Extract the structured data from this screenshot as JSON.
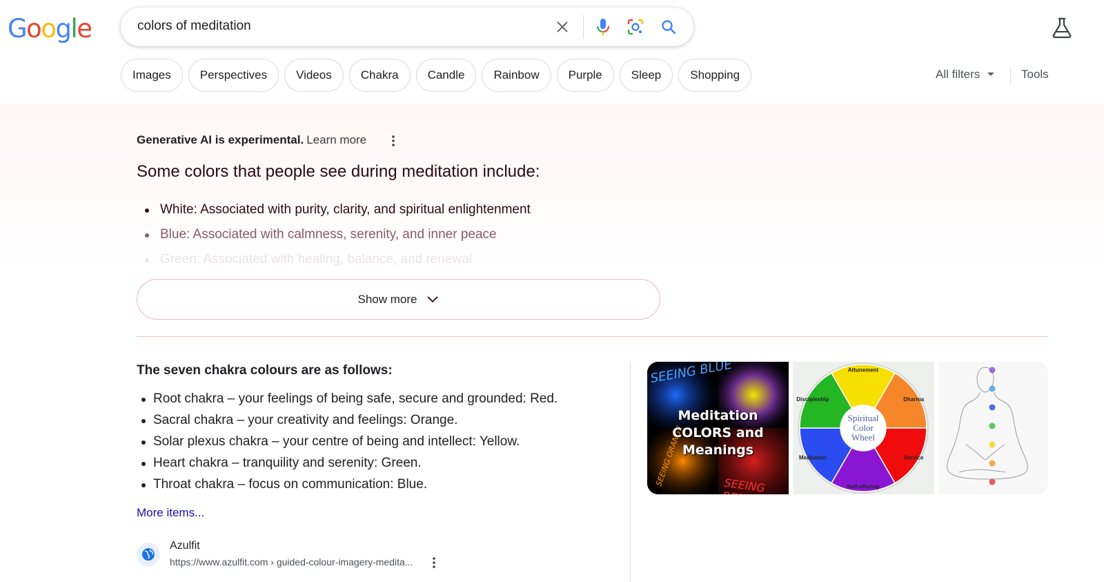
{
  "logo": {
    "text": "Google",
    "letters": [
      {
        "ch": "G",
        "color": "#4285f4"
      },
      {
        "ch": "o",
        "color": "#ea4335"
      },
      {
        "ch": "o",
        "color": "#fbbc05"
      },
      {
        "ch": "g",
        "color": "#4285f4"
      },
      {
        "ch": "l",
        "color": "#34a853"
      },
      {
        "ch": "e",
        "color": "#ea4335"
      }
    ]
  },
  "search": {
    "query": "colors of meditation",
    "icons": [
      "close-icon",
      "microphone-icon",
      "google-lens-icon",
      "search-icon"
    ]
  },
  "header": {
    "labs_icon": "flask-icon"
  },
  "chips": [
    "Images",
    "Perspectives",
    "Videos",
    "Chakra",
    "Candle",
    "Rainbow",
    "Purple",
    "Sleep",
    "Shopping"
  ],
  "filters": {
    "all_filters": "All filters",
    "tools": "Tools"
  },
  "ai_overview": {
    "notice": "Generative AI is experimental.",
    "learn_more": "Learn more",
    "headline": "Some colors that people see during meditation include:",
    "items": [
      "White: Associated with purity, clarity, and spiritual enlightenment",
      "Blue: Associated with calmness, serenity, and inner peace",
      "Green: Associated with healing, balance, and renewal"
    ],
    "show_more": "Show more"
  },
  "featured_snippet": {
    "title": "The seven chakra colours are as follows:",
    "items": [
      "Root chakra – your feelings of being safe, secure and grounded: Red.",
      "Sacral chakra – your creativity and feelings: Orange.",
      "Solar plexus chakra – your centre of being and intellect: Yellow.",
      "Heart chakra – tranquility and serenity: Green.",
      "Throat chakra – focus on communication: Blue."
    ],
    "more_items": "More items...",
    "source": {
      "name": "Azulfit",
      "url": "https://www.azulfit.com › guided-colour-imagery-medita..."
    }
  },
  "images": [
    {
      "title_lines": [
        "Meditation",
        "COLORS and",
        "Meanings"
      ],
      "scrawls": [
        "SEEING BLUE",
        "SEEING ORANGE",
        "SEEING RED"
      ]
    },
    {
      "center_lines": [
        "Spiritual",
        "Color",
        "Wheel"
      ],
      "segments": [
        {
          "label": "Attunement",
          "color": "#f7e000"
        },
        {
          "label": "Dharma",
          "color": "#f5872a"
        },
        {
          "label": "Service",
          "color": "#f00c0c"
        },
        {
          "label": "Self-offering",
          "color": "#8a16d4"
        },
        {
          "label": "Meditation",
          "color": "#2a4cf0"
        },
        {
          "label": "Discipleship",
          "color": "#25b624"
        }
      ]
    },
    {
      "chakra_dot_colors": [
        "#8a5ad6",
        "#4aa3ea",
        "#3253e0",
        "#39c24a",
        "#f2d21c",
        "#f39c2a",
        "#e2403b"
      ]
    }
  ]
}
